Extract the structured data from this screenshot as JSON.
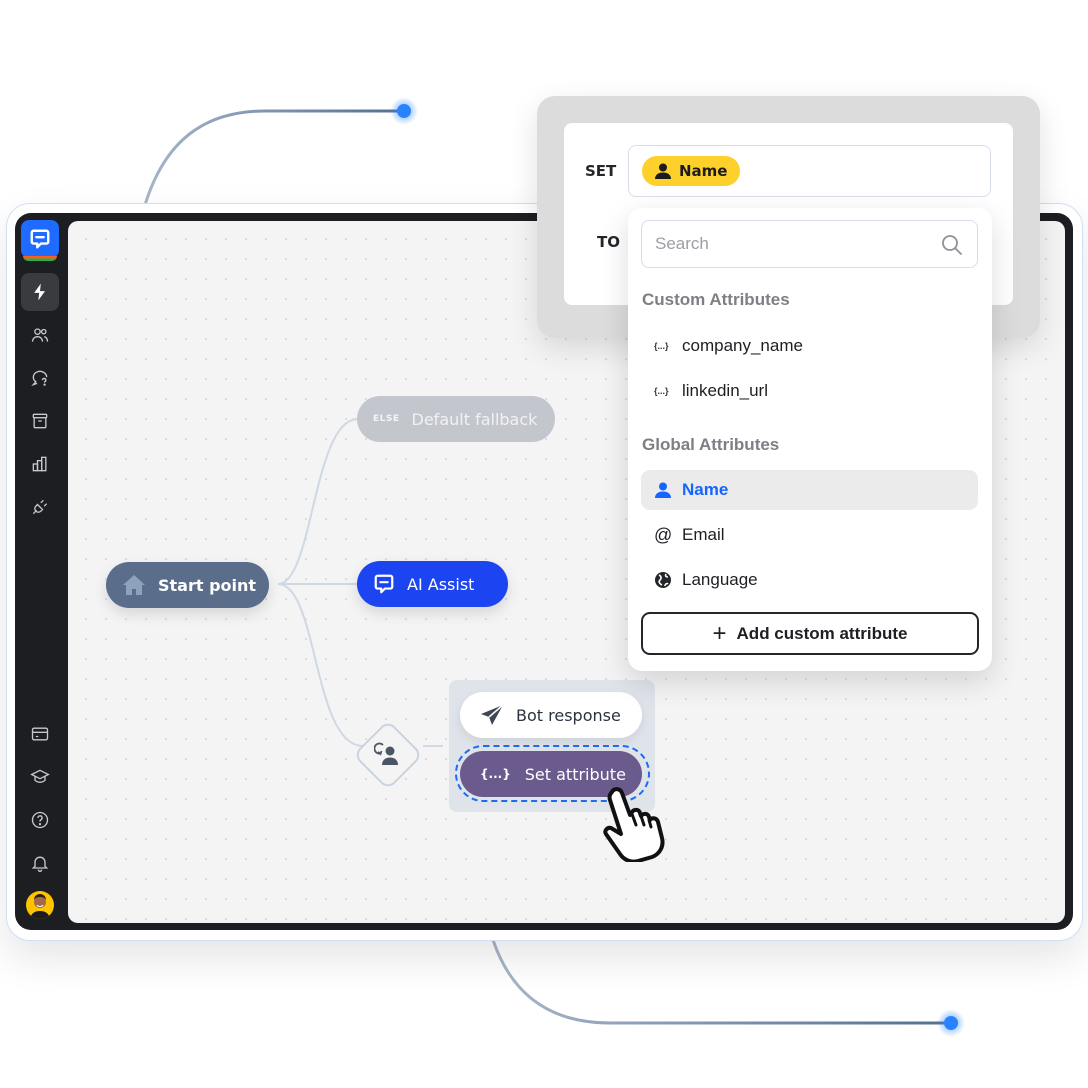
{
  "sidebar": {
    "logo": "chat-logo-icon",
    "top_items": [
      {
        "icon": "lightning-icon",
        "label": "Automations",
        "active": true
      },
      {
        "icon": "users-icon",
        "label": "Contacts",
        "active": false
      },
      {
        "icon": "chat-question-icon",
        "label": "Inbox",
        "active": false
      },
      {
        "icon": "archive-icon",
        "label": "Archive",
        "active": false
      },
      {
        "icon": "bar-chart-icon",
        "label": "Reports",
        "active": false
      },
      {
        "icon": "plug-icon",
        "label": "Integrations",
        "active": false
      }
    ],
    "bottom_items": [
      {
        "icon": "credit-card-icon",
        "label": "Billing"
      },
      {
        "icon": "graduation-cap-icon",
        "label": "Academy"
      },
      {
        "icon": "help-icon",
        "label": "Help"
      },
      {
        "icon": "bell-icon",
        "label": "Notifications"
      }
    ],
    "avatar": "user-avatar"
  },
  "flow": {
    "start": {
      "label": "Start point",
      "icon": "home-icon"
    },
    "else_branch": {
      "tag": "ELSE",
      "label": "Default fallback"
    },
    "ai_assist": {
      "label": "AI Assist",
      "icon": "chat-logo-icon"
    },
    "handoff_icon": "user-transfer-icon",
    "bot_response": {
      "label": "Bot response",
      "icon": "send-icon"
    },
    "set_attribute": {
      "label": "Set attribute",
      "icon_text": "{...}"
    }
  },
  "popover": {
    "set_label": "SET",
    "to_label": "TO",
    "selected_chip": "Name",
    "colors": {
      "chip": "#fdd02b",
      "selected_text": "#1565ff"
    }
  },
  "dropdown": {
    "search_placeholder": "Search",
    "custom_title": "Custom Attributes",
    "custom_items": [
      {
        "icon_text": "{...}",
        "label": "company_name"
      },
      {
        "icon_text": "{...}",
        "label": "linkedin_url"
      }
    ],
    "global_title": "Global Attributes",
    "global_items": [
      {
        "icon": "person-icon",
        "label": "Name",
        "selected": true
      },
      {
        "icon": "at-icon",
        "label": "Email",
        "selected": false
      },
      {
        "icon": "globe-icon",
        "label": "Language",
        "selected": false
      }
    ],
    "add_button": "Add custom attribute"
  }
}
